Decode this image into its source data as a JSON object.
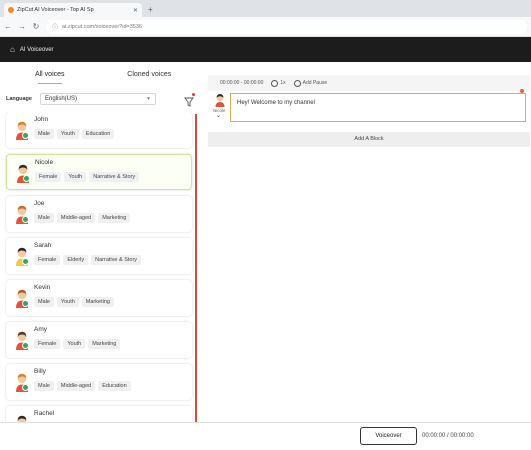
{
  "browser": {
    "tab_title": "ZipCut AI Voiceover - Top AI Sp",
    "tab_close": "✕",
    "new_tab": "+",
    "url": "ai.zipcut.com/voiceover?id=3536"
  },
  "header": {
    "title": "AI Voiceover"
  },
  "voice_tabs": {
    "all": "All voices",
    "cloned": "Cloned voices"
  },
  "language": {
    "label": "Language",
    "value": "English(US)"
  },
  "voices": [
    {
      "name": "John",
      "tags": [
        "Male",
        "Youth",
        "Education"
      ],
      "selected": false,
      "hair": "#d8842a",
      "shirt": "#e0543b"
    },
    {
      "name": "Nicole",
      "tags": [
        "Female",
        "Youth",
        "Narrative & Story"
      ],
      "selected": true,
      "hair": "#3b2a1e",
      "shirt": "#e0543b"
    },
    {
      "name": "Joe",
      "tags": [
        "Male",
        "Middle-aged",
        "Marketing"
      ],
      "selected": false,
      "hair": "#c96a2a",
      "shirt": "#e0543b"
    },
    {
      "name": "Sarah",
      "tags": [
        "Female",
        "Elderly",
        "Narrative & Story"
      ],
      "selected": false,
      "hair": "#2a2a2a",
      "shirt": "#f2c84a"
    },
    {
      "name": "Kevin",
      "tags": [
        "Male",
        "Youth",
        "Marketing"
      ],
      "selected": false,
      "hair": "#b85a2a",
      "shirt": "#e0543b"
    },
    {
      "name": "Amy",
      "tags": [
        "Female",
        "Youth",
        "Marketing"
      ],
      "selected": false,
      "hair": "#5a3a22",
      "shirt": "#e0543b"
    },
    {
      "name": "Billy",
      "tags": [
        "Male",
        "Middle-aged",
        "Education"
      ],
      "selected": false,
      "hair": "#d8842a",
      "shirt": "#e0543b"
    },
    {
      "name": "Rachel",
      "tags": [],
      "selected": false,
      "hair": "#3b2a1e",
      "shirt": "#e0543b"
    }
  ],
  "editor": {
    "timestamp": "00:00:00 - 00:00:00",
    "speed_label": "1x",
    "pause_label": "Add Pause",
    "block_voice": "Nicole",
    "text": "Hey! Welcome to my channel",
    "add_block": "Add A Block"
  },
  "footer": {
    "voiceover_button": "Voiceover",
    "time": "00:00:00 / 00:00:00"
  }
}
